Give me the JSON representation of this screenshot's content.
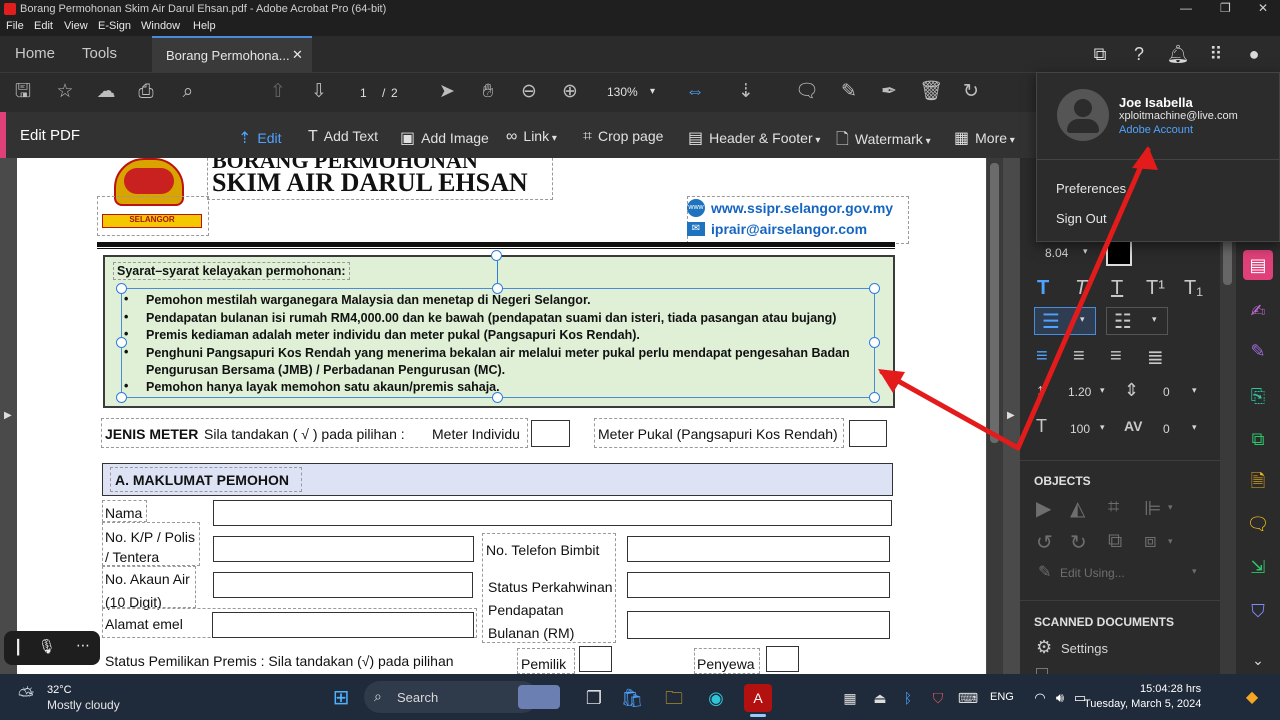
{
  "window": {
    "title": "Borang Permohonan Skim Air Darul Ehsan.pdf - Adobe Acrobat Pro (64-bit)",
    "controls": {
      "minimize": "—",
      "maximize": "❐",
      "close": "✕"
    }
  },
  "menu": [
    "File",
    "Edit",
    "View",
    "E-Sign",
    "Window",
    "Help"
  ],
  "tabs": {
    "home": "Home",
    "tools": "Tools",
    "document": "Borang Permohona...",
    "close": "✕"
  },
  "toolbar": {
    "page_current": "1",
    "page_sep": "/",
    "page_total": "2",
    "zoom": "130%"
  },
  "editbar": {
    "title": "Edit PDF",
    "items": [
      "Edit",
      "Add Text",
      "Add Image",
      "Link",
      "Crop page",
      "Header & Footer",
      "Watermark",
      "More"
    ]
  },
  "document": {
    "heading_top": "BORANG PERMOHONAN",
    "heading_main": "SKIM AIR DARUL EHSAN",
    "website": "www.ssipr.selangor.gov.my",
    "email": "iprair@airselangor.com",
    "logo_text": "SELANGOR",
    "eligibility_title": "Syarat–syarat kelayakan permohonan:",
    "eligibility_items": [
      "Pemohon mestilah warganegara Malaysia dan menetap di Negeri Selangor.",
      "Pendapatan bulanan isi rumah RM4,000.00 dan ke bawah (pendapatan suami dan isteri, tiada pasangan atau bujang)",
      "Premis kediaman adalah meter individu dan meter pukal (Pangsapuri Kos Rendah).",
      "Penghuni Pangsapuri Kos Rendah yang menerima bekalan air melalui meter pukal perlu mendapat pengesahan Badan",
      "Pengurusan Bersama (JMB) / Perbadanan Pengurusan (MC).",
      "Pemohon hanya layak memohon satu akaun/premis sahaja."
    ],
    "meter_label": "JENIS METER",
    "meter_instruction": "Sila tandakan ( √ ) pada pilihan :",
    "meter_individual": "Meter Individu",
    "meter_bulk": "Meter Pukal (Pangsapuri Kos Rendah)",
    "section_a": "A. MAKLUMAT PEMOHON",
    "fields": {
      "nama": "Nama",
      "ic_1": "No. K/P / Polis",
      "ic_2": "/ Tentera",
      "phone": "No. Telefon Bimbit",
      "account_1": "No. Akaun Air",
      "account_2": "(10 Digit)",
      "marital": "Status Perkahwinan",
      "income_1": "Pendapatan",
      "income_2": "Bulanan (RM)",
      "email": "Alamat emel",
      "premise_status": "Status Pemilikan Premis : Sila tandakan (√) pada pilihan",
      "owner": "Pemilik",
      "tenant": "Penyewa"
    }
  },
  "account_popup": {
    "name": "Joe Isabella",
    "email": "xploitmachine@live.com",
    "link": "Adobe Account",
    "preferences": "Preferences",
    "sign_out": "Sign Out"
  },
  "right_panel": {
    "font_size": "8.04",
    "line_spacing": "1.20",
    "para_spacing": "0",
    "horiz_scale": "100",
    "char_spacing": "0",
    "objects_title": "OBJECTS",
    "edit_using": "Edit Using...",
    "scanned_title": "SCANNED DOCUMENTS",
    "settings": "Settings"
  },
  "taskbar": {
    "weather_temp": "32°C",
    "weather_desc": "Mostly cloudy",
    "search": "Search",
    "lang": "ENG",
    "time": "15:04:28 hrs",
    "date": "Tuesday, March 5, 2024"
  },
  "colors": {
    "accent": "#e0407a",
    "selection": "#2f7de1",
    "annotation_arrow": "#e41b1b",
    "eligibility_bg": "#dff0d6",
    "section_bg": "#dde3f5"
  }
}
